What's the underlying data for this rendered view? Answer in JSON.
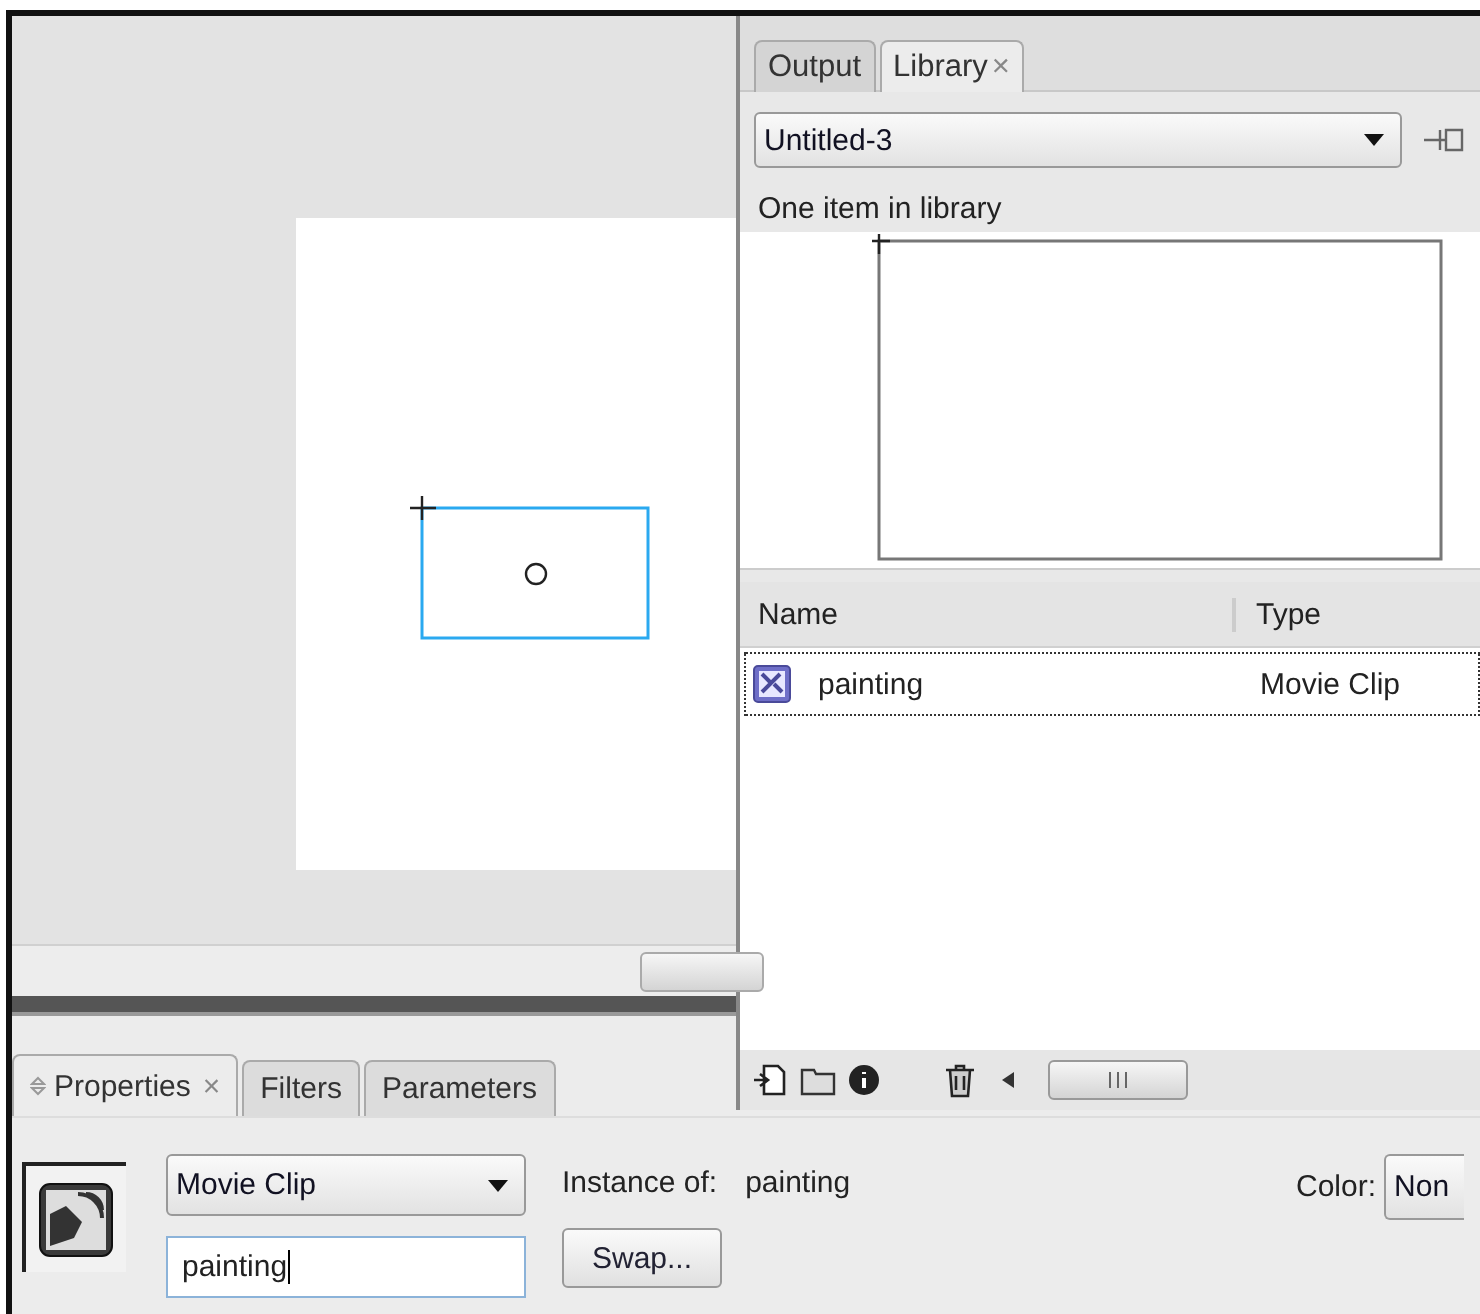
{
  "library_panel": {
    "tabs": [
      {
        "label": "Output",
        "selected": false
      },
      {
        "label": "Library",
        "selected": true,
        "close": "×"
      }
    ],
    "document_select": {
      "value": "Untitled-3"
    },
    "item_count": "One item in library",
    "columns": [
      "Name",
      "Type"
    ],
    "items": [
      {
        "name": "painting",
        "type": "Movie Clip",
        "selected": true
      }
    ]
  },
  "properties_panel": {
    "tabs": [
      {
        "label": "Properties",
        "selected": true,
        "close": "×"
      },
      {
        "label": "Filters",
        "selected": false
      },
      {
        "label": "Parameters",
        "selected": false
      }
    ],
    "symbol_type": {
      "value": "Movie Clip"
    },
    "instance_name": {
      "value": "painting"
    },
    "instance_of_label": "Instance of:",
    "instance_of_value": "painting",
    "swap_button": "Swap...",
    "color_label": "Color:",
    "color_select": {
      "value": "Non"
    }
  }
}
